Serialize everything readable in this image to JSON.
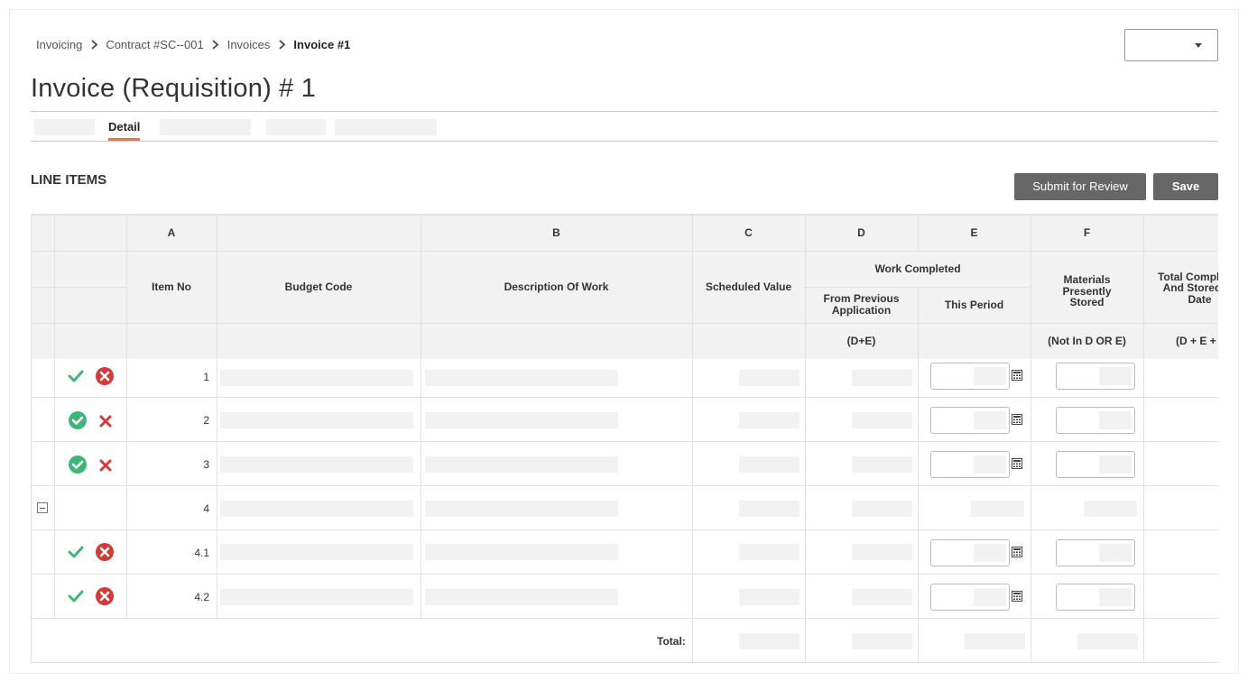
{
  "breadcrumb": {
    "items": [
      "Invoicing",
      "Contract #SC--001",
      "Invoices",
      "Invoice #1"
    ]
  },
  "header": {
    "title": "Invoice (Requisition) # 1",
    "select_value": ""
  },
  "tabs": {
    "active": "Detail"
  },
  "section": {
    "title": "LINE ITEMS",
    "submit_label": "Submit for Review",
    "save_label": "Save"
  },
  "table": {
    "letters": {
      "a": "A",
      "b": "B",
      "c": "C",
      "d": "D",
      "e": "E",
      "f": "F"
    },
    "headers": {
      "item_no": "Item No",
      "budget_code": "Budget Code",
      "description": "Description Of Work",
      "scheduled_value": "Scheduled Value",
      "work_completed": "Work Completed",
      "from_previous": "From Previous Application",
      "this_period": "This Period",
      "materials": "Materials Presently Stored",
      "total_completed": "Total Completed And Stored To Date"
    },
    "formulas": {
      "d": "(D+E)",
      "f": "(Not In D OR E)",
      "g": "(D + E + F)"
    },
    "rows": [
      {
        "item_no": "1",
        "status": "approve-reject-alt"
      },
      {
        "item_no": "2",
        "status": "approved-circle"
      },
      {
        "item_no": "3",
        "status": "approved-circle"
      },
      {
        "item_no": "4",
        "status": "group"
      },
      {
        "item_no": "4.1",
        "status": "approve-reject-alt"
      },
      {
        "item_no": "4.2",
        "status": "approve-reject-alt"
      }
    ],
    "total_label": "Total:"
  },
  "colors": {
    "accent": "#e8793a",
    "button": "#666666",
    "approve": "#3fb57a",
    "reject": "#d33a3a"
  }
}
